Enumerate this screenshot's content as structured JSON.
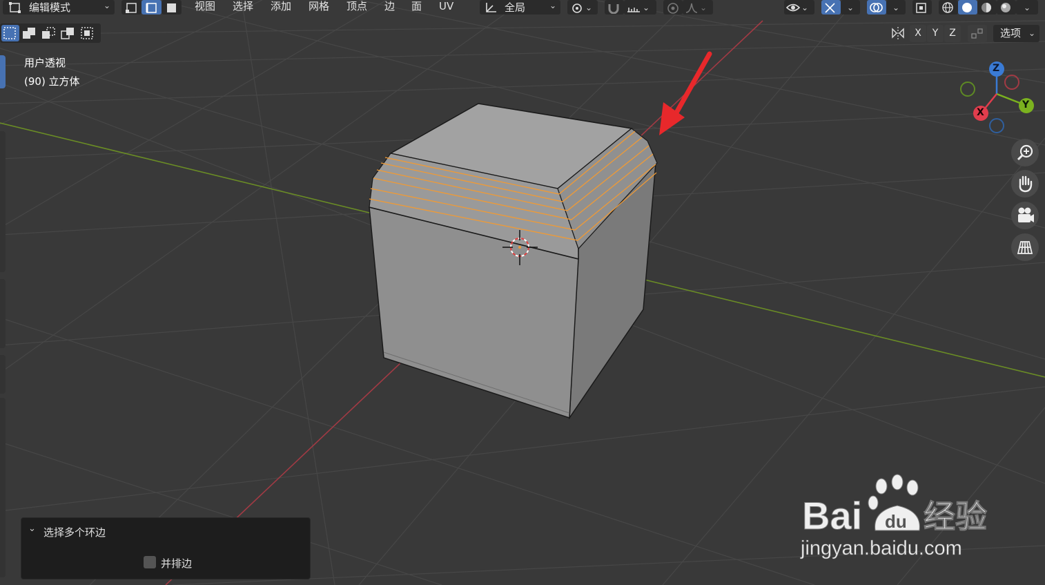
{
  "header": {
    "mode_dropdown": "编辑模式",
    "menus": [
      "视图",
      "选择",
      "添加",
      "网格",
      "顶点",
      "边",
      "面",
      "UV"
    ],
    "transform_orientation": "全局",
    "options_label": "选项",
    "axes": [
      "X",
      "Y",
      "Z"
    ]
  },
  "viewport": {
    "view_name": "用户透视",
    "object_info": "(90) 立方体"
  },
  "gizmo": {
    "z": "Z",
    "y": "Y",
    "x": "X"
  },
  "operator_panel": {
    "title": "选择多个环边",
    "checkbox_label": "并排边",
    "checkbox_checked": false
  },
  "watermark": {
    "logo_text": "Bai du 经验",
    "url": "jingyan.baidu.com"
  },
  "colors": {
    "background": "#393939",
    "grid": "#4b4b4b",
    "x_axis": "#a23a44",
    "y_axis": "#6a8c25",
    "selected_edge": "#f09a35",
    "accent_blue": "#4772b3",
    "annotation_arrow": "#e8282b"
  }
}
